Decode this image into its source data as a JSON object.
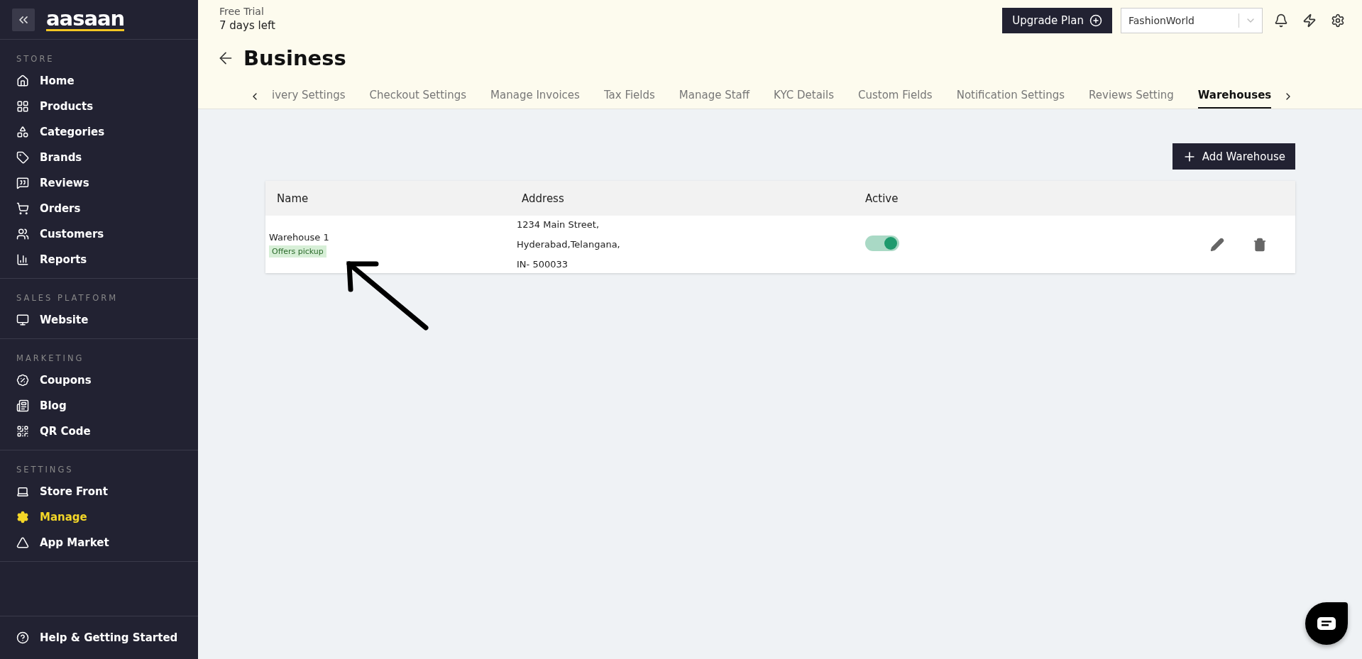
{
  "sidebar": {
    "logo": "aasaan",
    "sections": [
      {
        "title": "STORE",
        "items": [
          {
            "label": "Home",
            "selected": false
          },
          {
            "label": "Products",
            "selected": false
          },
          {
            "label": "Categories",
            "selected": false
          },
          {
            "label": "Brands",
            "selected": false
          },
          {
            "label": "Reviews",
            "selected": false
          },
          {
            "label": "Orders",
            "selected": false
          },
          {
            "label": "Customers",
            "selected": false
          },
          {
            "label": "Reports",
            "selected": false
          }
        ]
      },
      {
        "title": "SALES PLATFORM",
        "items": [
          {
            "label": "Website",
            "selected": false
          }
        ]
      },
      {
        "title": "MARKETING",
        "items": [
          {
            "label": "Coupons",
            "selected": false
          },
          {
            "label": "Blog",
            "selected": false
          },
          {
            "label": "QR Code",
            "selected": false
          }
        ]
      },
      {
        "title": "SETTINGS",
        "items": [
          {
            "label": "Store Front",
            "selected": false
          },
          {
            "label": "Manage",
            "selected": true
          },
          {
            "label": "App Market",
            "selected": false
          }
        ]
      }
    ],
    "footer": "Help & Getting Started"
  },
  "header": {
    "trial": "Free Trial",
    "days_left": "7 days left",
    "upgrade_button": "Upgrade Plan",
    "store_select": "FashionWorld",
    "title": "Business"
  },
  "tabs": [
    {
      "label": "ivery Settings",
      "selected": false
    },
    {
      "label": "Checkout Settings",
      "selected": false
    },
    {
      "label": "Manage Invoices",
      "selected": false
    },
    {
      "label": "Tax Fields",
      "selected": false
    },
    {
      "label": "Manage Staff",
      "selected": false
    },
    {
      "label": "KYC Details",
      "selected": false
    },
    {
      "label": "Custom Fields",
      "selected": false
    },
    {
      "label": "Notification Settings",
      "selected": false
    },
    {
      "label": "Reviews Setting",
      "selected": false
    },
    {
      "label": "Warehouses",
      "selected": true
    }
  ],
  "add_button": "Add Warehouse",
  "table": {
    "columns": [
      "Name",
      "Address",
      "Active"
    ],
    "rows": [
      {
        "name": "Warehouse 1",
        "badge": "Offers pickup",
        "address": [
          "1234 Main Street,",
          "Hyderabad,Telangana,",
          "IN- 500033"
        ],
        "active": true
      }
    ]
  }
}
